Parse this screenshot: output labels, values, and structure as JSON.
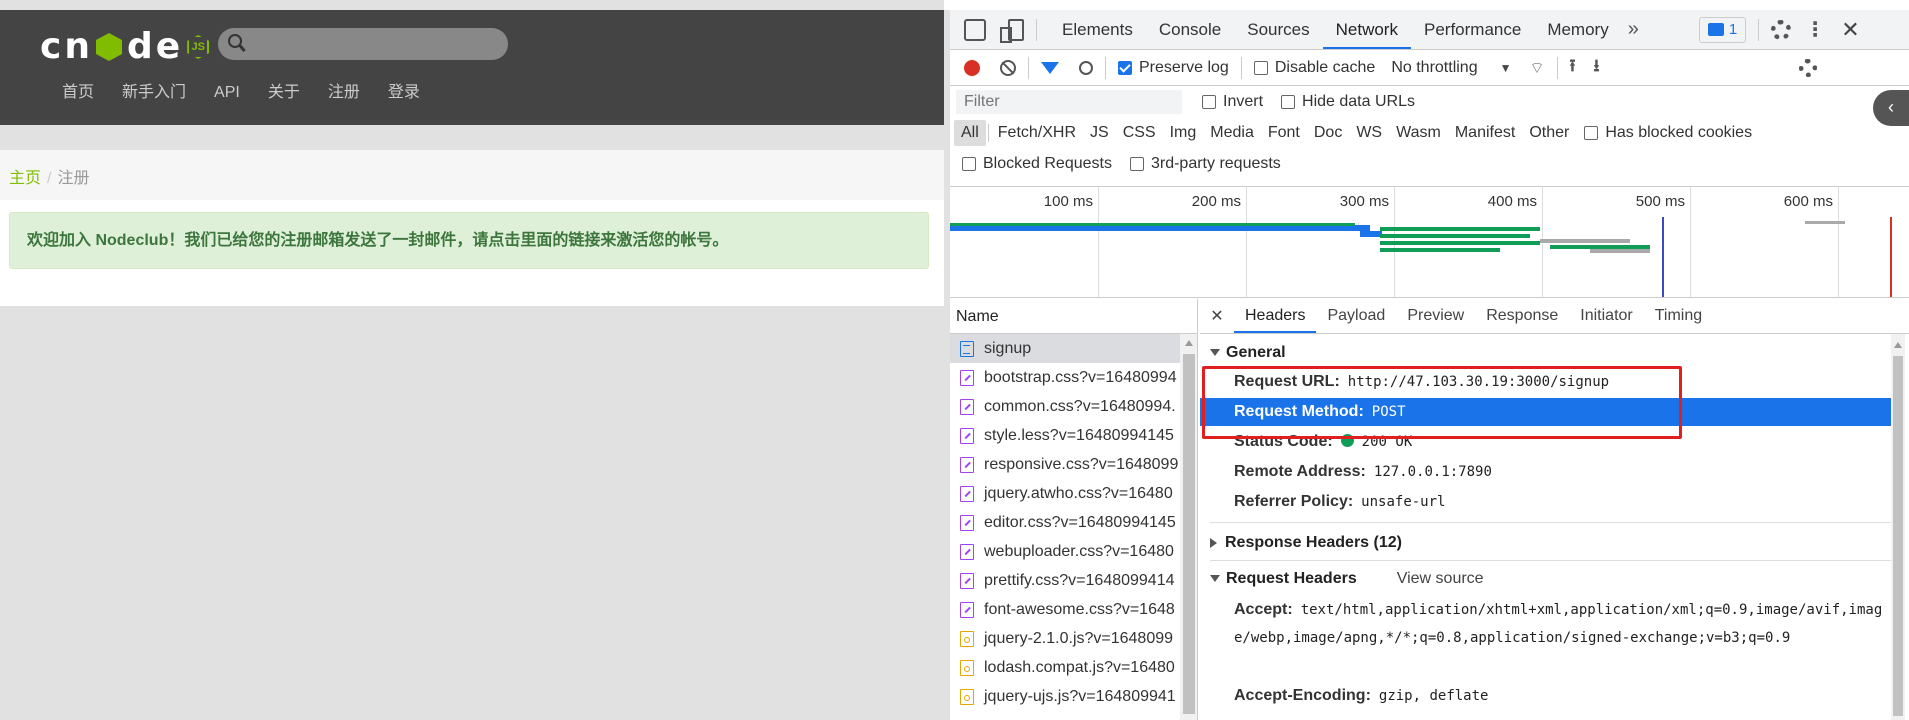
{
  "site": {
    "logo_letters": [
      "c",
      "n",
      "d",
      "e"
    ],
    "logo_badge": "JS",
    "nav": [
      "首页",
      "新手入门",
      "API",
      "关于",
      "注册",
      "登录"
    ],
    "breadcrumb": {
      "home": "主页",
      "sep": "/",
      "current": "注册"
    },
    "alert": "欢迎加入 Nodeclub！我们已给您的注册邮箱发送了一封邮件，请点击里面的链接来激活您的帐号。"
  },
  "devtools": {
    "tabs": [
      "Elements",
      "Console",
      "Sources",
      "Network",
      "Performance",
      "Memory"
    ],
    "active_tab": "Network",
    "more_tabs": "»",
    "issues_count": "1",
    "controls": {
      "preserve_log": "Preserve log",
      "disable_cache": "Disable cache",
      "throttling": "No throttling"
    },
    "filter": {
      "placeholder": "Filter",
      "invert": "Invert",
      "hide_data_urls": "Hide data URLs"
    },
    "types": [
      "All",
      "Fetch/XHR",
      "JS",
      "CSS",
      "Img",
      "Media",
      "Font",
      "Doc",
      "WS",
      "Wasm",
      "Manifest",
      "Other"
    ],
    "has_blocked_cookies": "Has blocked cookies",
    "blocked_requests": "Blocked Requests",
    "third_party": "3rd-party requests",
    "timeline_ticks": [
      "100 ms",
      "200 ms",
      "300 ms",
      "400 ms",
      "500 ms",
      "600 ms"
    ],
    "name_header": "Name",
    "requests": [
      {
        "name": "signup",
        "type": "doc"
      },
      {
        "name": "bootstrap.css?v=16480994",
        "type": "css"
      },
      {
        "name": "common.css?v=16480994.",
        "type": "css"
      },
      {
        "name": "style.less?v=16480994145",
        "type": "css"
      },
      {
        "name": "responsive.css?v=1648099",
        "type": "css"
      },
      {
        "name": "jquery.atwho.css?v=16480",
        "type": "css"
      },
      {
        "name": "editor.css?v=16480994145",
        "type": "css"
      },
      {
        "name": "webuploader.css?v=16480",
        "type": "css"
      },
      {
        "name": "prettify.css?v=1648099414",
        "type": "css"
      },
      {
        "name": "font-awesome.css?v=1648",
        "type": "css"
      },
      {
        "name": "jquery-2.1.0.js?v=1648099",
        "type": "js"
      },
      {
        "name": "lodash.compat.js?v=16480",
        "type": "js"
      },
      {
        "name": "jquery-ujs.js?v=164809941",
        "type": "js"
      }
    ],
    "detail_tabs": [
      "Headers",
      "Payload",
      "Preview",
      "Response",
      "Initiator",
      "Timing"
    ],
    "general": {
      "title": "General",
      "request_url_k": "Request URL:",
      "request_url_v": "http://47.103.30.19:3000/signup",
      "method_k": "Request Method:",
      "method_v": "POST",
      "status_k": "Status Code:",
      "status_v": "200 OK",
      "remote_k": "Remote Address:",
      "remote_v": "127.0.0.1:7890",
      "referrer_k": "Referrer Policy:",
      "referrer_v": "unsafe-url"
    },
    "response_headers": "Response Headers (12)",
    "request_headers": {
      "title": "Request Headers",
      "view_source": "View source",
      "accept_k": "Accept:",
      "accept_v": "text/html,application/xhtml+xml,application/xml;q=0.9,image/avif,image/webp,image/apng,*/*;q=0.8,application/signed-exchange;v=b3;q=0.9",
      "encoding_k": "Accept-Encoding:",
      "encoding_v": "gzip, deflate"
    }
  }
}
